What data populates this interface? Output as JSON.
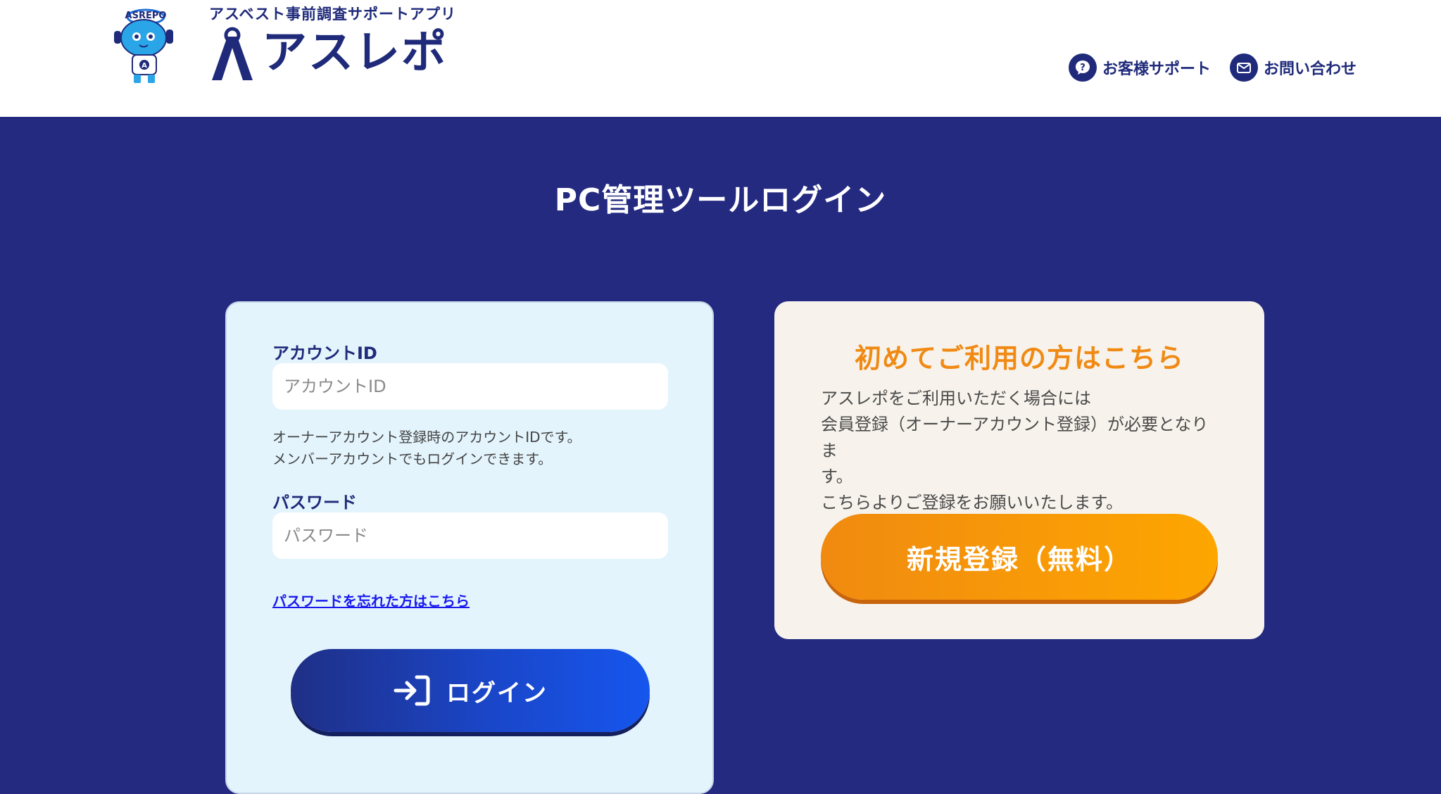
{
  "header": {
    "tagline": "アスベスト事前調査サポートアプリ",
    "logo_text": "アスレポ",
    "mascot_text": "ASREPO",
    "nav": [
      {
        "label": "お客様サポート",
        "icon": "question-chat-icon"
      },
      {
        "label": "お問い合わせ",
        "icon": "mail-icon"
      }
    ]
  },
  "page_title": "PC管理ツールログイン",
  "login": {
    "account_label": "アカウントID",
    "account_placeholder": "アカウントID",
    "hint_line1": "オーナーアカウント登録時のアカウントIDです。",
    "hint_line2": "メンバーアカウントでもログインできます。",
    "password_label": "パスワード",
    "password_placeholder": "パスワード",
    "forgot_link": "パスワードを忘れた方はこちら",
    "login_button": "ログイン"
  },
  "register": {
    "title": "初めてご利用の方はこちら",
    "desc_line1": "アスレポをご利用いただく場合には",
    "desc_line2": "会員登録（オーナーアカウント登録）が必要となりま",
    "desc_line3": "す。",
    "desc_line4": "こちらよりご登録をお願いいたします。",
    "button": "新規登録（無料）"
  },
  "colors": {
    "navy": "#232a80",
    "brand_text": "#1f2a7a",
    "orange": "#f08a14",
    "login_card_bg": "#e3f4fc",
    "register_card_bg": "#f7f3ec"
  }
}
